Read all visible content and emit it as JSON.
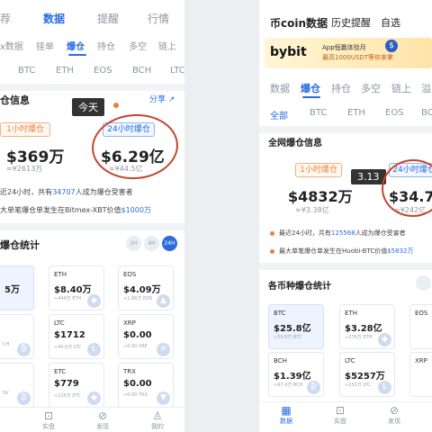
{
  "left": {
    "top_tabs": [
      "荐",
      "数据",
      "提醒",
      "行情"
    ],
    "sub_tabs": [
      "x数据",
      "挂单",
      "爆仓",
      "持仓",
      "多空",
      "链上"
    ],
    "coins": [
      "BTC",
      "ETH",
      "EOS",
      "BCH",
      "LTC"
    ],
    "section_title": "仓信息",
    "share": "分享",
    "badge": "今天",
    "pill_1h": "1小时爆仓",
    "pill_24h": "24小时爆仓",
    "val_1h": "$369万",
    "sub_1h": "≈¥2613万",
    "val_24h": "$6.29亿",
    "sub_24h": "≈¥44.5亿",
    "info1_pre": "近24小时，共有",
    "info1_num": "34707",
    "info1_post": "人成为爆仓受害者",
    "info2_pre": "大单笔爆仓单发生在Bitmex-XBT价值",
    "info2_num": "$1000万",
    "stats_title": "爆仓统计",
    "segments": [
      "1H",
      "4H",
      "24H"
    ],
    "cards": [
      {
        "name": "",
        "value": "5万",
        "sub": ""
      },
      {
        "name": "ETH",
        "value": "$8.40万",
        "sub": "≈444万 ETH"
      },
      {
        "name": "EOS",
        "value": "$4.09万",
        "sub": "≈1.86万 EOS"
      },
      {
        "name": "",
        "value": "",
        "sub": "CH"
      },
      {
        "name": "LTC",
        "value": "$1712",
        "sub": "≈40.0万 LTC"
      },
      {
        "name": "XRP",
        "value": "$0.00",
        "sub": "≈0.00 XRP"
      },
      {
        "name": "",
        "value": "",
        "sub": "SV"
      },
      {
        "name": "ETC",
        "value": "$779",
        "sub": "≈125万 ETC"
      },
      {
        "name": "TRX",
        "value": "$0.00",
        "sub": "≈0.00 TRX"
      }
    ],
    "nav": [
      "实盘",
      "发现",
      "我的"
    ]
  },
  "right": {
    "header_tabs": [
      "币coin数据",
      "历史提醒",
      "自选"
    ],
    "ad_brand": "bybit",
    "ad_line1": "App恒赢体验月",
    "ad_line2": "最高1000USDT等你来拿",
    "sub_tabs": [
      "数据",
      "爆仓",
      "持仓",
      "多空",
      "链上",
      "溢"
    ],
    "coins": [
      "全部",
      "BTC",
      "ETH",
      "EOS",
      "BCH"
    ],
    "section_title": "全网爆仓信息",
    "badge": "3.13",
    "pill_1h": "1小时爆仓",
    "pill_24h": "24小时爆仓",
    "val_1h": "$4832万",
    "sub_1h": "≈¥3.38亿",
    "val_24h": "$34.7亿",
    "sub_24h": "≈¥242亿",
    "info1_pre": "最近24小时，共有",
    "info1_num": "125568",
    "info1_post": "人成为爆仓受害者",
    "info2_pre": "最大单笔爆仓单发生在Huobi-BTC价值",
    "info2_num": "$5832万",
    "stats_title": "各币种爆仓统计",
    "cards": [
      {
        "name": "BTC",
        "value": "$25.8亿",
        "sub": "≈59.8万 BTC"
      },
      {
        "name": "ETH",
        "value": "$3.28亿",
        "sub": "≈276万 ETH"
      },
      {
        "name": "EOS",
        "value": "",
        "sub": ""
      },
      {
        "name": "BCH",
        "value": "$1.39亿",
        "sub": "≈67.4万 BCH"
      },
      {
        "name": "LTC",
        "value": "$5257万",
        "sub": "≈153万 LTC"
      },
      {
        "name": "XRP",
        "value": "",
        "sub": ""
      }
    ],
    "nav": [
      "数据",
      "实盘",
      "发现"
    ]
  },
  "colors": {
    "accent": "#2a6ce0",
    "orange": "#e8843c",
    "ink_circle": "#c4452c"
  }
}
